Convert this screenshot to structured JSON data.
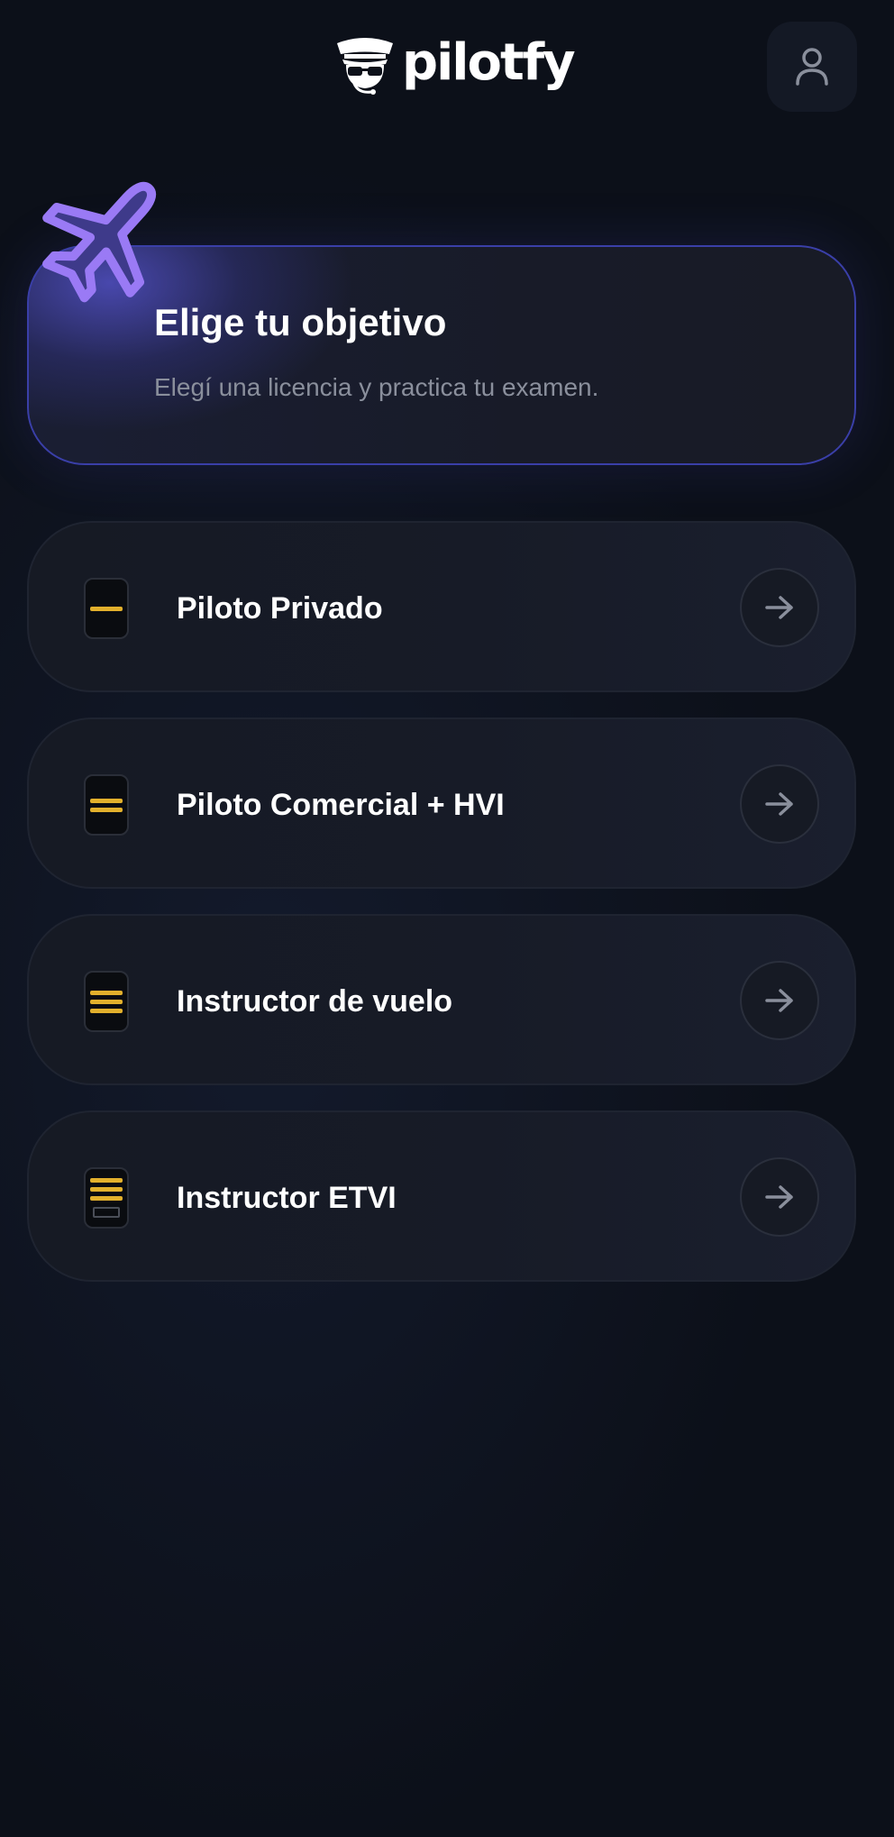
{
  "header": {
    "brand_name": "pilotfy",
    "logo_icon": "pilot-face-icon",
    "profile_icon": "user-icon"
  },
  "hero": {
    "title": "Elige tu objetivo",
    "subtitle": "Elegí una licencia y practica tu examen.",
    "icon": "airplane-icon"
  },
  "licenses": [
    {
      "label": "Piloto Privado",
      "stripes": 1
    },
    {
      "label": "Piloto Comercial + HVI",
      "stripes": 2
    },
    {
      "label": "Instructor de vuelo",
      "stripes": 3
    },
    {
      "label": "Instructor ETVI",
      "stripes": 3
    }
  ],
  "colors": {
    "background": "#0c1019",
    "card": "#171b27",
    "accent": "#8f6ef0",
    "hero_border": "#3a3fa8",
    "stripe_gold": "#e2b02c",
    "subtitle": "#8a8f9c"
  }
}
